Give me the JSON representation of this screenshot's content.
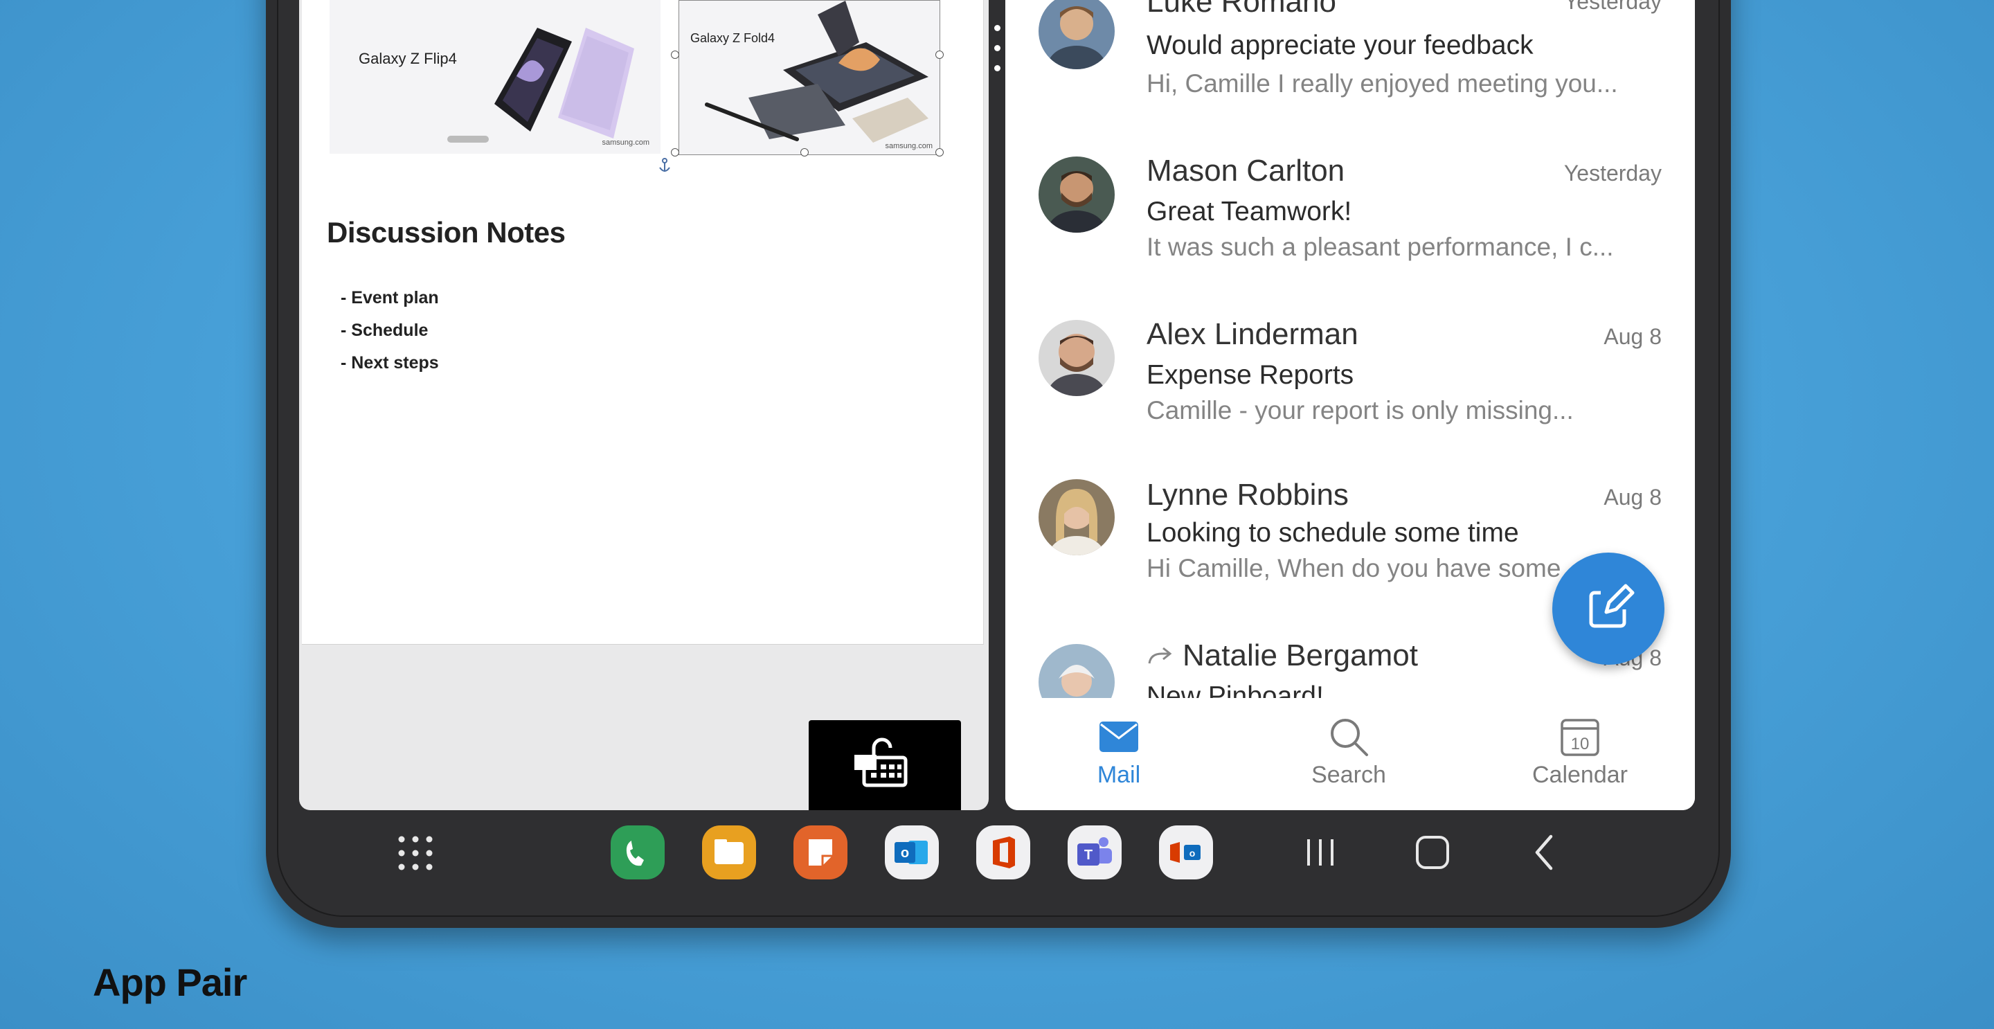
{
  "doc": {
    "image1_label": "Galaxy Z Flip4",
    "image2_label": "Galaxy Z Fold4",
    "image_footer": "samsung.com",
    "heading": "Discussion Notes",
    "bullets": [
      "- Event plan",
      "- Schedule",
      "- Next steps"
    ]
  },
  "mail": {
    "items": [
      {
        "sender": "Luke Romano",
        "date": "Yesterday",
        "subject": "Would appreciate your feedback",
        "preview": "Hi, Camille I really enjoyed meeting you...",
        "avatar_color": "#c9a27e"
      },
      {
        "sender": "Mason Carlton",
        "date": "Yesterday",
        "subject": "Great Teamwork!",
        "preview": "It was such a pleasant performance, I c...",
        "avatar_color": "#8a6a4e"
      },
      {
        "sender": "Alex Linderman",
        "date": "Aug 8",
        "subject": "Expense Reports",
        "preview": "Camille - your report is only missing...",
        "avatar_color": "#b48a72"
      },
      {
        "sender": "Lynne Robbins",
        "date": "Aug 8",
        "subject": "Looking to schedule some time",
        "preview": "Hi Camille, When do you have some",
        "avatar_color": "#a8927a"
      },
      {
        "sender": "Natalie Bergamot",
        "date": "Aug 8",
        "subject": "New Pinboard!",
        "preview": "",
        "avatar_color": "#9fb8cc",
        "forwarded": true
      }
    ],
    "nav": [
      {
        "label": "Mail",
        "icon": "mail-icon",
        "active": true
      },
      {
        "label": "Search",
        "icon": "search-icon",
        "active": false
      },
      {
        "label": "Calendar",
        "icon": "calendar-icon",
        "active": false,
        "calendar_day": "10"
      }
    ],
    "accent": "#2f86d8"
  },
  "taskbar": {
    "apps": [
      {
        "name": "phone-app-icon",
        "color": "#2e9e57"
      },
      {
        "name": "files-app-icon",
        "color": "#e8a020"
      },
      {
        "name": "notes-app-icon",
        "color": "#e2642a"
      },
      {
        "name": "outlook-app-icon",
        "color": "#f0f0f2"
      },
      {
        "name": "office-app-icon",
        "color": "#f0f0f2"
      },
      {
        "name": "teams-app-icon",
        "color": "#f0f0f2"
      },
      {
        "name": "app-pair-icon",
        "color": "#f0f0f2"
      }
    ]
  },
  "caption": "App Pair"
}
